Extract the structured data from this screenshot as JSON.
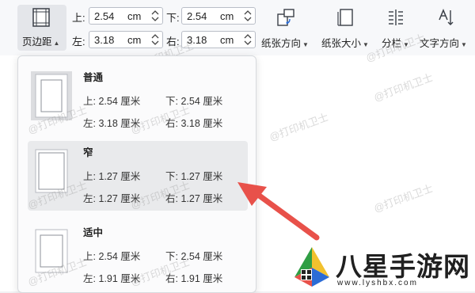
{
  "ribbon": {
    "margins_button": {
      "label": "页边距",
      "icon": "page-margins-icon"
    },
    "top": {
      "label": "上:",
      "value": "2.54",
      "unit": "cm"
    },
    "bottom": {
      "label": "下:",
      "value": "2.54",
      "unit": "cm"
    },
    "left": {
      "label": "左:",
      "value": "3.18",
      "unit": "cm"
    },
    "right": {
      "label": "右:",
      "value": "3.18",
      "unit": "cm"
    },
    "tools": [
      {
        "label": "纸张方向",
        "icon": "page-orientation-icon"
      },
      {
        "label": "纸张大小",
        "icon": "paper-size-icon"
      },
      {
        "label": "分栏",
        "icon": "columns-icon"
      },
      {
        "label": "文字方向",
        "icon": "text-direction-icon"
      }
    ]
  },
  "presets": [
    {
      "name": "普通",
      "top": "上: 2.54 厘米",
      "bottom": "下: 2.54 厘米",
      "left": "左: 3.18 厘米",
      "right": "右: 3.18 厘米"
    },
    {
      "name": "窄",
      "top": "上: 1.27 厘米",
      "bottom": "下: 1.27 厘米",
      "left": "左: 1.27 厘米",
      "right": "右: 1.27 厘米"
    },
    {
      "name": "适中",
      "top": "上: 2.54 厘米",
      "bottom": "下: 2.54 厘米",
      "left": "左: 1.91 厘米",
      "right": "右: 1.91 厘米"
    }
  ],
  "watermark": "@打印机卫士",
  "brand": {
    "name": "八星手游网",
    "url": "www.lyshbx.com"
  },
  "colors": {
    "arrow": "#e8514a",
    "highlight": "#e9eaec",
    "panel_border": "#d7dade"
  }
}
